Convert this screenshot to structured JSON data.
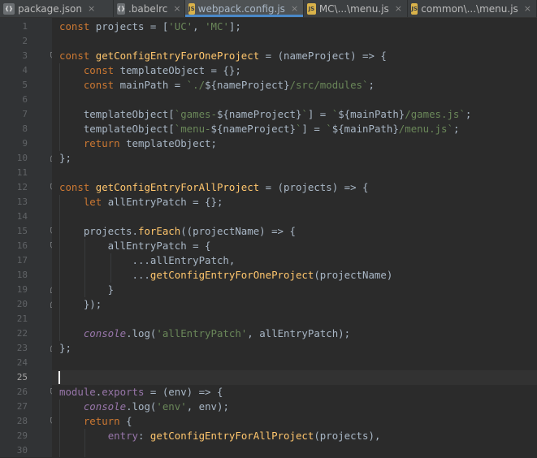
{
  "tabs": [
    {
      "label": "package.json",
      "icon": "json-file-icon",
      "active": false
    },
    {
      "label": ".babelrc",
      "icon": "babel-file-icon",
      "active": false
    },
    {
      "label": "webpack.config.js",
      "icon": "js-file-icon",
      "active": true
    },
    {
      "label": "MC\\...\\menu.js",
      "icon": "js-file-icon",
      "active": false
    },
    {
      "label": "common\\...\\menu.js",
      "icon": "js-file-icon",
      "active": false
    }
  ],
  "close_glyph": "×",
  "current_line": 25,
  "lines": [
    {
      "n": "1",
      "tokens": [
        [
          "kw",
          "const "
        ],
        [
          "plain",
          "projects = ["
        ],
        [
          "str",
          "'UC'"
        ],
        [
          "plain",
          ", "
        ],
        [
          "str",
          "'MC'"
        ],
        [
          "plain",
          "];"
        ]
      ]
    },
    {
      "n": "2",
      "tokens": []
    },
    {
      "n": "3",
      "tokens": [
        [
          "kw",
          "const "
        ],
        [
          "fn",
          "getConfigEntryForOneProject"
        ],
        [
          "plain",
          " = (nameProject) => {"
        ]
      ]
    },
    {
      "n": "4",
      "tokens": [
        [
          "plain",
          "    "
        ],
        [
          "kw",
          "const "
        ],
        [
          "plain",
          "templateObject = {};"
        ]
      ]
    },
    {
      "n": "5",
      "tokens": [
        [
          "plain",
          "    "
        ],
        [
          "kw",
          "const "
        ],
        [
          "plain",
          "mainPath = "
        ],
        [
          "str",
          "`./"
        ],
        [
          "plain",
          "${nameProject}"
        ],
        [
          "str",
          "/src/modules`"
        ],
        [
          "plain",
          ";"
        ]
      ]
    },
    {
      "n": "6",
      "tokens": []
    },
    {
      "n": "7",
      "tokens": [
        [
          "plain",
          "    templateObject["
        ],
        [
          "str",
          "`games-"
        ],
        [
          "plain",
          "${nameProject}"
        ],
        [
          "str",
          "`"
        ],
        [
          "plain",
          "] = "
        ],
        [
          "str",
          "`"
        ],
        [
          "plain",
          "${mainPath}"
        ],
        [
          "str",
          "/games.js`"
        ],
        [
          "plain",
          ";"
        ]
      ]
    },
    {
      "n": "8",
      "tokens": [
        [
          "plain",
          "    templateObject["
        ],
        [
          "str",
          "`menu-"
        ],
        [
          "plain",
          "${nameProject}"
        ],
        [
          "str",
          "`"
        ],
        [
          "plain",
          "] = "
        ],
        [
          "str",
          "`"
        ],
        [
          "plain",
          "${mainPath}"
        ],
        [
          "str",
          "/menu.js`"
        ],
        [
          "plain",
          ";"
        ]
      ]
    },
    {
      "n": "9",
      "tokens": [
        [
          "plain",
          "    "
        ],
        [
          "kw",
          "return "
        ],
        [
          "plain",
          "templateObject;"
        ]
      ]
    },
    {
      "n": "10",
      "tokens": [
        [
          "plain",
          "};"
        ]
      ]
    },
    {
      "n": "11",
      "tokens": []
    },
    {
      "n": "12",
      "tokens": [
        [
          "kw",
          "const "
        ],
        [
          "fn",
          "getConfigEntryForAllProject"
        ],
        [
          "plain",
          " = (projects) => {"
        ]
      ]
    },
    {
      "n": "13",
      "tokens": [
        [
          "plain",
          "    "
        ],
        [
          "kw",
          "let "
        ],
        [
          "plain",
          "allEntryPatch = {};"
        ]
      ]
    },
    {
      "n": "14",
      "tokens": []
    },
    {
      "n": "15",
      "tokens": [
        [
          "plain",
          "    projects."
        ],
        [
          "fn",
          "forEach"
        ],
        [
          "plain",
          "((projectName) => {"
        ]
      ]
    },
    {
      "n": "16",
      "tokens": [
        [
          "plain",
          "        allEntryPatch = {"
        ]
      ]
    },
    {
      "n": "17",
      "tokens": [
        [
          "plain",
          "            ...allEntryPatch,"
        ]
      ]
    },
    {
      "n": "18",
      "tokens": [
        [
          "plain",
          "            ..."
        ],
        [
          "fn",
          "getConfigEntryForOneProject"
        ],
        [
          "plain",
          "(projectName)"
        ]
      ]
    },
    {
      "n": "19",
      "tokens": [
        [
          "plain",
          "        }"
        ]
      ]
    },
    {
      "n": "20",
      "tokens": [
        [
          "plain",
          "    });"
        ]
      ]
    },
    {
      "n": "21",
      "tokens": []
    },
    {
      "n": "22",
      "tokens": [
        [
          "plain",
          "    "
        ],
        [
          "glob",
          "console"
        ],
        [
          "plain",
          ".log("
        ],
        [
          "str",
          "'allEntryPatch'"
        ],
        [
          "plain",
          ", allEntryPatch);"
        ]
      ]
    },
    {
      "n": "23",
      "tokens": [
        [
          "plain",
          "};"
        ]
      ]
    },
    {
      "n": "24",
      "tokens": []
    },
    {
      "n": "25",
      "tokens": []
    },
    {
      "n": "26",
      "tokens": [
        [
          "prop",
          "module"
        ],
        [
          "plain",
          "."
        ],
        [
          "prop",
          "exports"
        ],
        [
          "plain",
          " = (env) => {"
        ]
      ]
    },
    {
      "n": "27",
      "tokens": [
        [
          "plain",
          "    "
        ],
        [
          "glob",
          "console"
        ],
        [
          "plain",
          ".log("
        ],
        [
          "str",
          "'env'"
        ],
        [
          "plain",
          ", env);"
        ]
      ]
    },
    {
      "n": "28",
      "tokens": [
        [
          "plain",
          "    "
        ],
        [
          "kw",
          "return "
        ],
        [
          "plain",
          "{"
        ]
      ]
    },
    {
      "n": "29",
      "tokens": [
        [
          "plain",
          "        "
        ],
        [
          "prop",
          "entry"
        ],
        [
          "plain",
          ": "
        ],
        [
          "fn",
          "getConfigEntryForAllProject"
        ],
        [
          "plain",
          "(projects),"
        ]
      ]
    },
    {
      "n": "30",
      "tokens": []
    }
  ],
  "colors": {
    "background": "#2b2b2b",
    "gutter": "#313335",
    "keyword": "#cc7832",
    "string": "#6a8759",
    "function": "#ffc66d",
    "property": "#9876aa",
    "text": "#a9b7c6",
    "tab_active_underline": "#4a88c7"
  }
}
